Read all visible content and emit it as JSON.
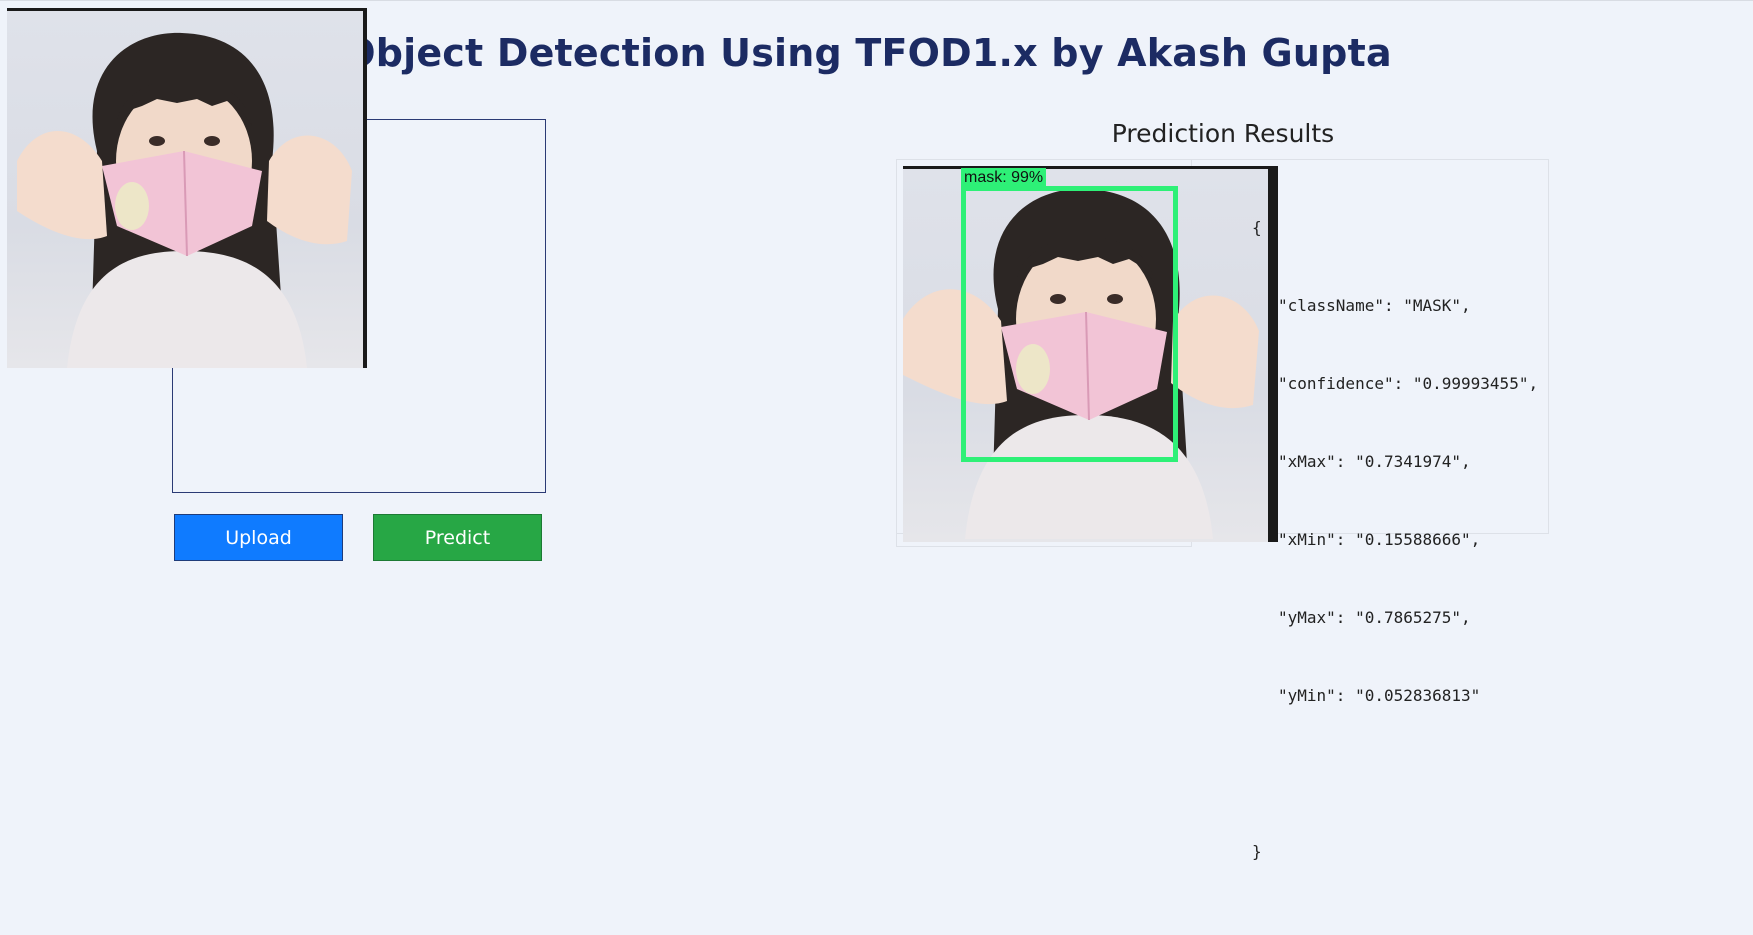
{
  "page": {
    "title": "Object Detection Using TFOD1.x by Akash Gupta"
  },
  "left_panel": {
    "upload_button": "Upload",
    "predict_button": "Predict",
    "upload_color": "#0f7bff",
    "predict_color": "#27a745"
  },
  "results": {
    "heading": "Prediction Results",
    "detection_label": "mask: 99%",
    "bbox_color": "#2ef077",
    "json_lines": [
      "{",
      "\"className\": \"MASK\",",
      "\"confidence\": \"0.99993455\",",
      "\"xMax\": \"0.7341974\",",
      "\"xMin\": \"0.15588666\",",
      "\"yMax\": \"0.7865275\",",
      "\"yMin\": \"0.052836813\"",
      "",
      "}"
    ]
  }
}
